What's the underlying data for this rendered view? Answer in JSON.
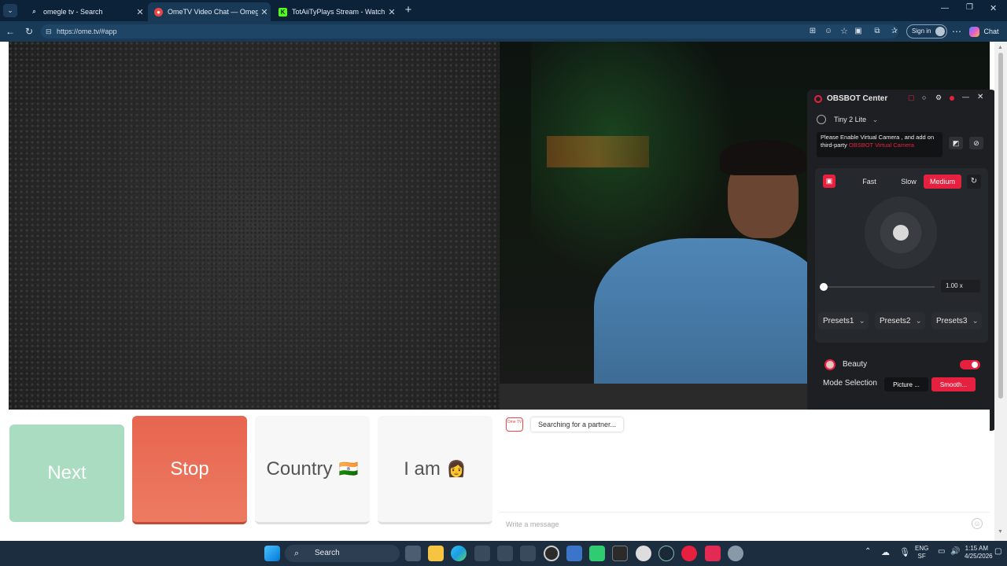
{
  "browser": {
    "tabs": [
      {
        "title": "omegle tv - Search",
        "favicon": "search-icon",
        "active": false
      },
      {
        "title": "OmeTV Video Chat — Omegle",
        "favicon": "ometv-icon",
        "active": true
      },
      {
        "title": "TotAiiTyPlays Stream - Watch Live",
        "favicon": "kick-icon",
        "active": false
      }
    ],
    "url": "https://ome.tv/#app",
    "sign_in_label": "Sign in",
    "chat_label": "Chat"
  },
  "page": {
    "buttons": {
      "next": "Next",
      "stop": "Stop",
      "country": "Country",
      "country_flag": "🇮🇳",
      "iam": "I am",
      "iam_emoji": "👩"
    },
    "chat": {
      "status": "Searching for a partner...",
      "logo_text": "Ome TV",
      "input_placeholder": "Write a message"
    },
    "colors": {
      "next_bg": "#a9dcc0",
      "stop_bg": "#e8654f",
      "obsbot_accent": "#e6213f"
    }
  },
  "obsbot": {
    "title": "OBSBOT Center",
    "device": "Tiny 2 Lite",
    "notice_prefix": "Please Enable Virtual Camera , and add on third-party ",
    "notice_link": "OBSBOT Virtual Camera",
    "speeds": [
      "Fast",
      "Slow",
      "Medium"
    ],
    "selected_speed": "Medium",
    "zoom": "1.00 x",
    "presets": [
      "Presets1",
      "Presets2",
      "Presets3"
    ],
    "beauty_label": "Beauty",
    "beauty_enabled": true,
    "mode_label": "Mode Selection",
    "modes": [
      "Picture ...",
      "Smooth..."
    ],
    "selected_mode": "Smooth..."
  },
  "taskbar": {
    "search_label": "Search",
    "lang": "ENG",
    "region": "SF",
    "time": "1:15 AM",
    "date": "4/25/2026"
  }
}
